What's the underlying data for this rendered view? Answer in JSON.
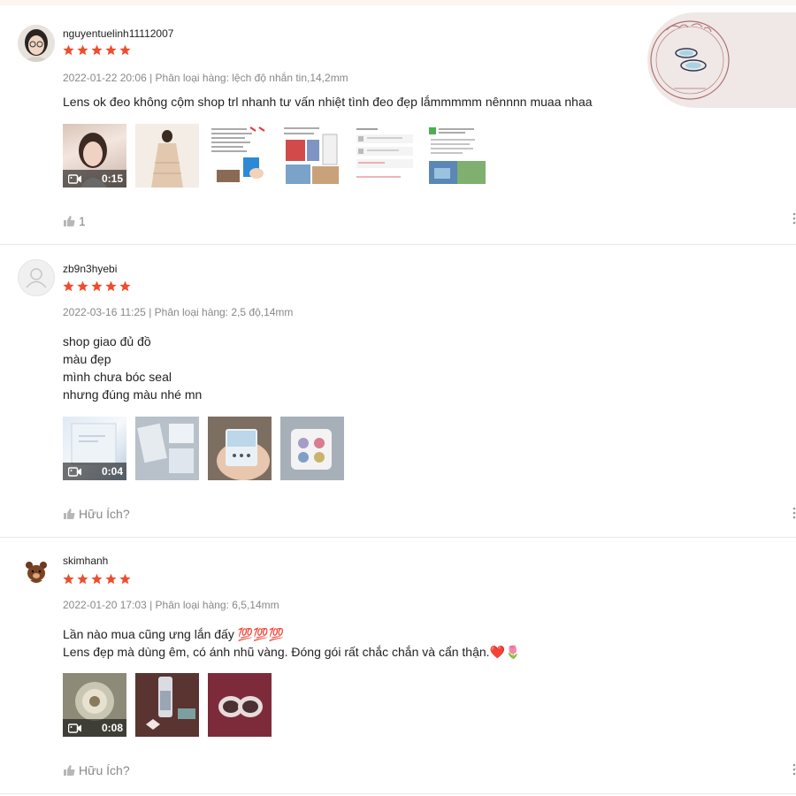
{
  "reviews": [
    {
      "username": "nguyentuelinh11112007",
      "rating": 5,
      "meta": "2022-01-22 20:06 | Phân loại hàng: lệch độ nhắn tin,14,2mm",
      "comment": "Lens ok đeo không cộm shop trl nhanh tư vấn nhiệt tình đeo đẹp lắmmmmm nênnnn muaa nhaa",
      "video_duration": "0:15",
      "like_label": "1"
    },
    {
      "username": "zb9n3hyebi",
      "rating": 5,
      "meta": "2022-03-16 11:25 | Phân loại hàng: 2,5 độ,14mm",
      "comment": "shop giao đủ đồ\nmàu đẹp\nmình chưa bóc seal\nnhưng đúng màu nhé mn",
      "video_duration": "0:04",
      "like_label": "Hữu Ích?"
    },
    {
      "username": "skimhanh",
      "rating": 5,
      "meta": "2022-01-20 17:03 | Phân loại hàng: 6,5,14mm",
      "comment": "Lần nào mua cũng ưng lắn đấy 💯💯💯\nLens đẹp mà dùng êm, có ánh nhũ vàng. Đóng gói rất chắc chắn và cẩn thận.❤️🌷",
      "video_duration": "0:08",
      "like_label": "Hữu Ích?"
    }
  ],
  "colors": {
    "star": "#ee4d2d",
    "muted": "#888888",
    "divider": "#e8e8e8"
  }
}
